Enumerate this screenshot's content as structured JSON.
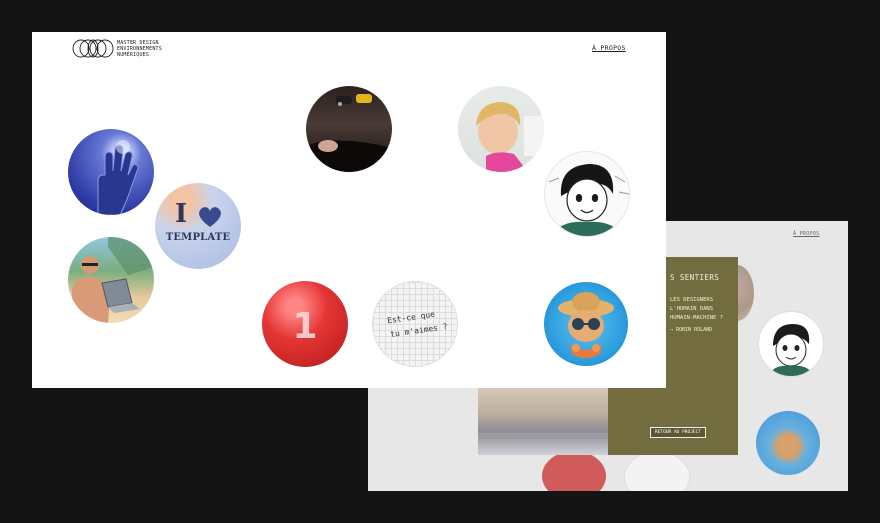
{
  "front": {
    "logo_text": [
      "MASTER DESIGN",
      "ENVIRONNEMENTS",
      "NUMÉRIQUES"
    ],
    "about_link": "À PROPOS",
    "circles": {
      "template_letter": "I",
      "template_word": "TEMPLATE",
      "one_digit": "1",
      "note_line1": "Est-ce que",
      "note_line2": "tu m'aimes ?"
    }
  },
  "back": {
    "about_link": "À PROPOS",
    "panel_title": "S SENTIERS",
    "panel_lines": [
      "LES DESIGNERS",
      "L'HUMAIN DANS",
      "HUMAIN-MACHINE ?"
    ],
    "panel_author": "→ ROBIN ROLAND",
    "panel_button": "RETOUR AU PROJECT"
  },
  "colors": {
    "page_bg": "#141414",
    "panel_olive": "#726c3f",
    "accent_red": "#e53535"
  }
}
